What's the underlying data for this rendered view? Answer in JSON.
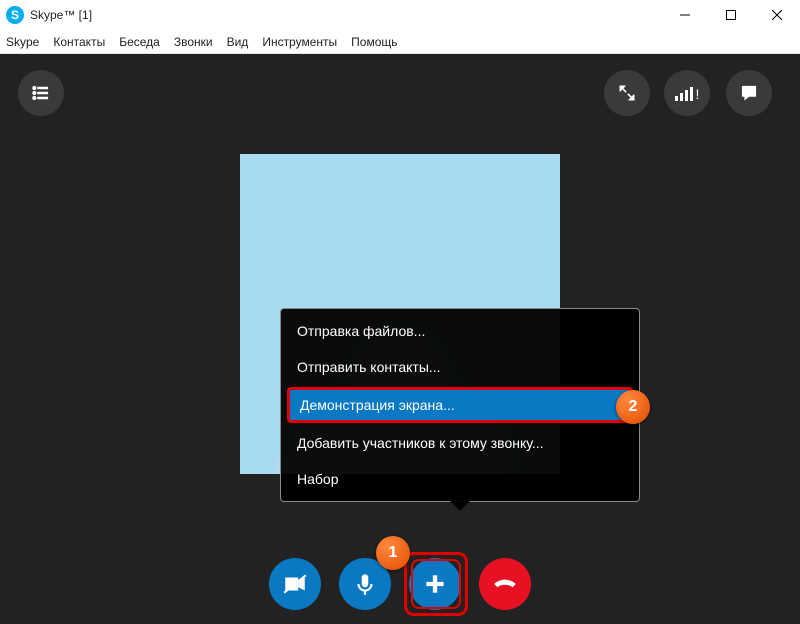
{
  "window": {
    "title": "Skype™ [1]"
  },
  "menu": {
    "items": [
      "Skype",
      "Контакты",
      "Беседа",
      "Звонки",
      "Вид",
      "Инструменты",
      "Помощь"
    ]
  },
  "popup": {
    "items": [
      "Отправка файлов...",
      "Отправить контакты...",
      "Демонстрация экрана...",
      "Добавить участников к этому звонку...",
      "Набор"
    ],
    "selected_index": 2
  },
  "badges": {
    "b1": "1",
    "b2": "2"
  },
  "colors": {
    "accent": "#0a78c2",
    "hangup": "#e81123",
    "highlight": "#e30000",
    "badge": "#e24a00",
    "call_bg": "#222222",
    "avatar_bg": "#a9dbf0"
  }
}
